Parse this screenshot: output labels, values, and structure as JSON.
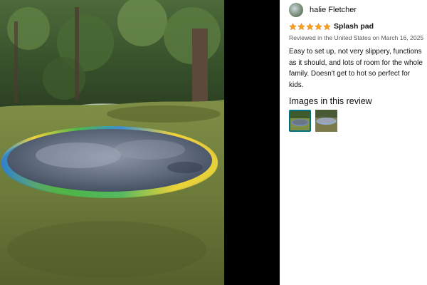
{
  "review": {
    "reviewer_name": "halie Fletcher",
    "rating": 5,
    "title": "Splash pad",
    "meta": "Reviewed in the United States on March 16, 2025",
    "body": "Easy to set up, not very slippery, functions as it should, and lots of room for the whole family. Doesn't get to hot so perfect for kids.",
    "images_heading": "Images in this review",
    "images": [
      {
        "selected": true
      },
      {
        "selected": false
      }
    ]
  },
  "colors": {
    "star": "#f7a21b",
    "selected_border": "#007185",
    "text": "#0f1111",
    "muted": "#565959"
  }
}
